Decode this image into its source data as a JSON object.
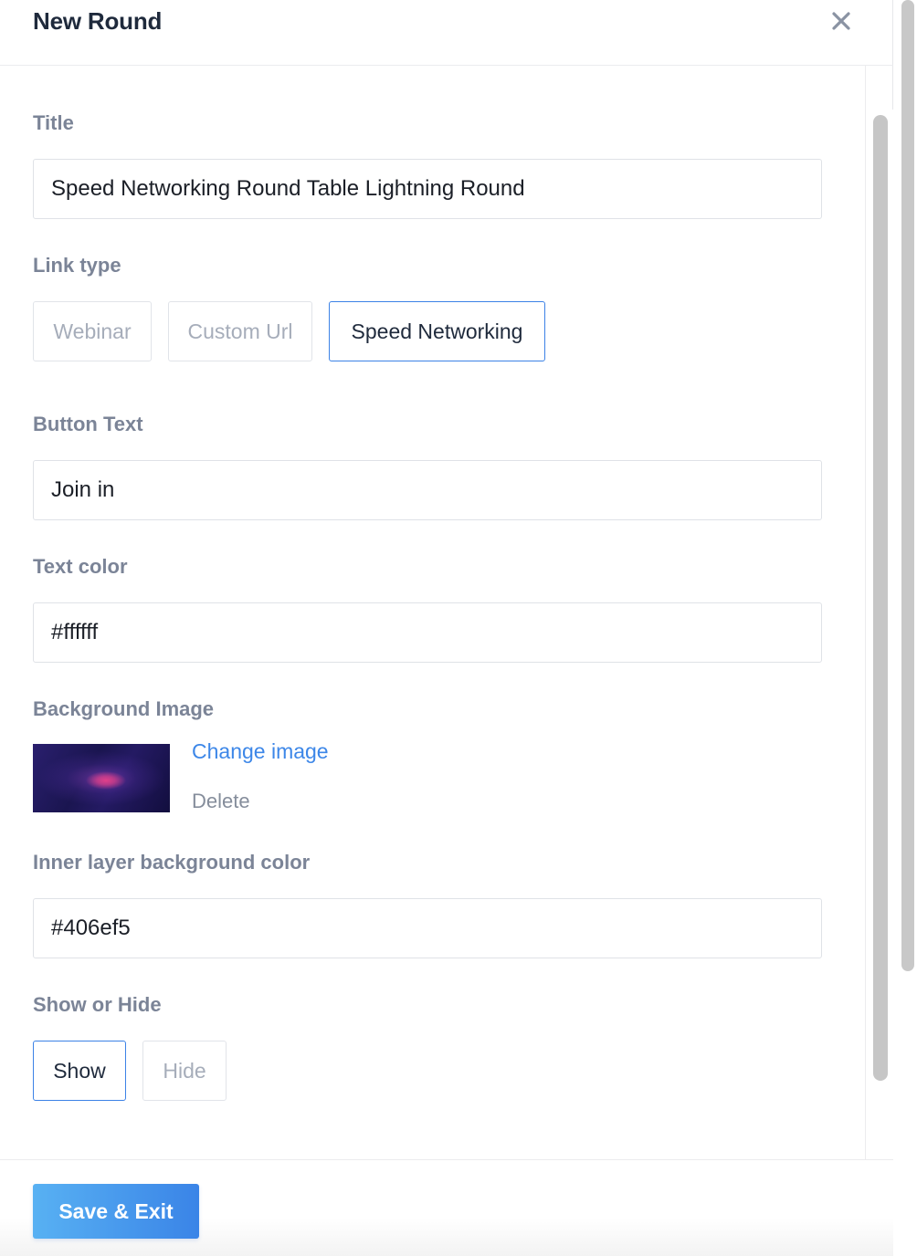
{
  "modal": {
    "title": "New Round",
    "close_icon": "close-icon"
  },
  "form": {
    "title": {
      "label": "Title",
      "value": "Speed Networking Round Table Lightning Round"
    },
    "link_type": {
      "label": "Link type",
      "options": [
        "Webinar",
        "Custom Url",
        "Speed Networking"
      ],
      "selected": "Speed Networking"
    },
    "button_text": {
      "label": "Button Text",
      "value": "Join in"
    },
    "text_color": {
      "label": "Text color",
      "value": "#ffffff"
    },
    "background_image": {
      "label": "Background Image",
      "change_label": "Change image",
      "delete_label": "Delete"
    },
    "inner_bg_color": {
      "label": "Inner layer background color",
      "value": "#406ef5"
    },
    "show_or_hide": {
      "label": "Show or Hide",
      "options": [
        "Show",
        "Hide"
      ],
      "selected": "Show"
    }
  },
  "footer": {
    "save_label": "Save & Exit"
  },
  "colors": {
    "accent": "#3c82e6",
    "link": "#3d87e8",
    "label": "#7b8497",
    "title": "#1f2a3c"
  }
}
